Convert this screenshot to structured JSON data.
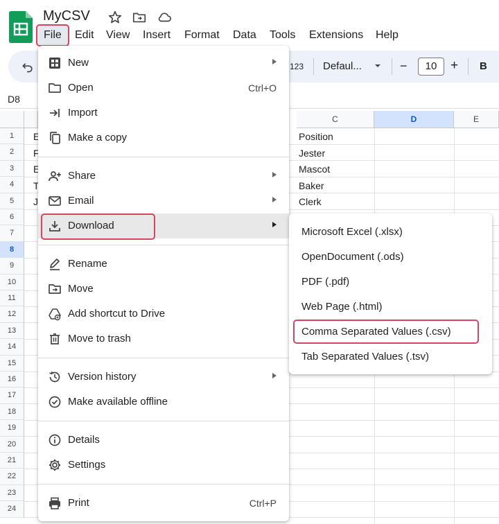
{
  "app": {
    "doc_title": "MyCSV",
    "menu": [
      "File",
      "Edit",
      "View",
      "Insert",
      "Format",
      "Data",
      "Tools",
      "Extensions",
      "Help"
    ]
  },
  "toolbar": {
    "number_format": "123",
    "font": "Defaul...",
    "font_size": "10",
    "decrease": "−",
    "increase": "+",
    "bold": "B"
  },
  "name_box": "D8",
  "columns": [
    "C",
    "D",
    "E"
  ],
  "rows": [
    "1",
    "2",
    "3",
    "4",
    "5",
    "6",
    "7",
    "8",
    "9",
    "10",
    "11",
    "12",
    "13",
    "14",
    "15",
    "16",
    "17",
    "18",
    "19",
    "20",
    "21",
    "22",
    "23",
    "24"
  ],
  "col_a_visible": [
    "E",
    "F",
    "E",
    "T",
    "J"
  ],
  "col_c_values": [
    "Position",
    "Jester",
    "Mascot",
    "Baker",
    "Clerk"
  ],
  "file_menu": {
    "new": "New",
    "open": "Open",
    "open_shortcut": "Ctrl+O",
    "import": "Import",
    "make_copy": "Make a copy",
    "share": "Share",
    "email": "Email",
    "download": "Download",
    "rename": "Rename",
    "move": "Move",
    "add_shortcut": "Add shortcut to Drive",
    "move_to_trash": "Move to trash",
    "version_history": "Version history",
    "make_offline": "Make available offline",
    "details": "Details",
    "settings": "Settings",
    "print": "Print",
    "print_shortcut": "Ctrl+P"
  },
  "download_menu": [
    "Microsoft Excel (.xlsx)",
    "OpenDocument (.ods)",
    "PDF (.pdf)",
    "Web Page (.html)",
    "Comma Separated Values (.csv)",
    "Tab Separated Values (.tsv)"
  ],
  "colors": {
    "highlight_border": "#d64560",
    "sheets_green": "#0f9d58",
    "selection_blue": "#d3e3fd"
  }
}
